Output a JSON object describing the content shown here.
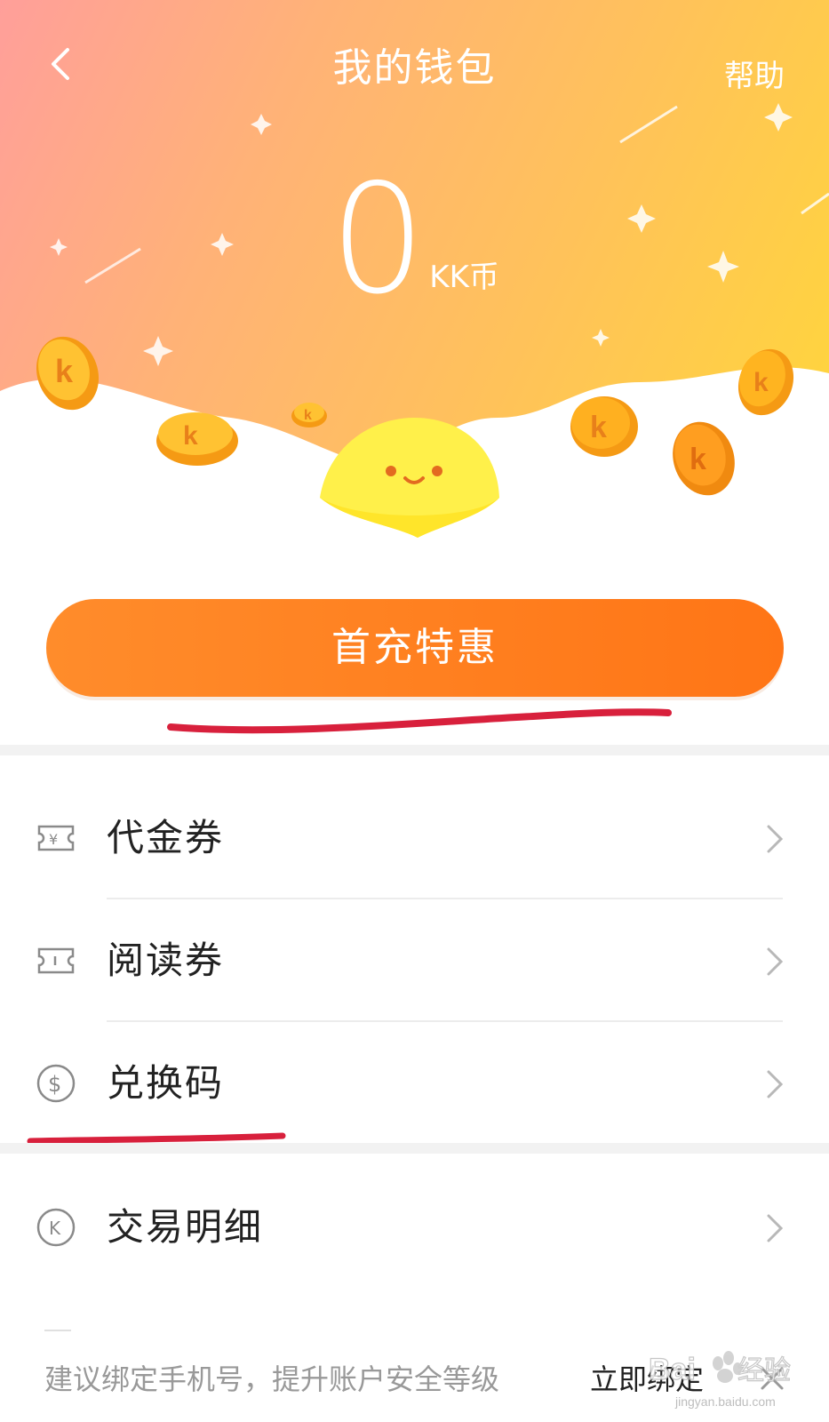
{
  "header": {
    "title": "我的钱包",
    "help_label": "帮助"
  },
  "wallet": {
    "balance": "0",
    "unit": "KK币"
  },
  "promo_button": {
    "label": "首充特惠"
  },
  "menu": {
    "items": [
      {
        "label": "代金券",
        "icon": "voucher-yen-icon"
      },
      {
        "label": "阅读券",
        "icon": "reading-ticket-icon"
      },
      {
        "label": "兑换码",
        "icon": "dollar-circle-icon"
      },
      {
        "label": "交易明细",
        "icon": "k-circle-icon"
      }
    ]
  },
  "footer": {
    "tip": "建议绑定手机号，提升账户安全等级",
    "bind_label": "立即绑定"
  },
  "colors": {
    "accent": "#ff7a1e",
    "annotation": "#d8203c"
  },
  "watermark": {
    "text": "Bai 经验",
    "sub": "jingyan.baidu.com"
  }
}
